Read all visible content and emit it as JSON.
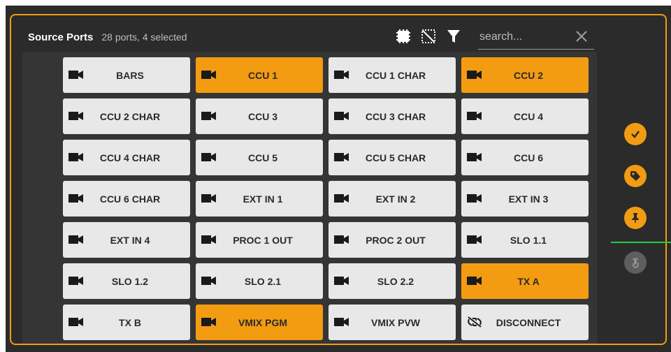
{
  "header": {
    "title": "Source Ports",
    "count_text": "28 ports, 4 selected"
  },
  "toolbar": {
    "icons": [
      "select-all-icon",
      "deselect-all-icon",
      "filter-icon"
    ],
    "search_placeholder": "search...",
    "search_value": "",
    "clear_icon": "close-icon"
  },
  "ports": [
    {
      "label": "BARS",
      "selected": false,
      "icon": "camera-icon"
    },
    {
      "label": "CCU 1",
      "selected": true,
      "icon": "camera-icon"
    },
    {
      "label": "CCU 1 CHAR",
      "selected": false,
      "icon": "camera-icon"
    },
    {
      "label": "CCU 2",
      "selected": true,
      "icon": "camera-icon"
    },
    {
      "label": "CCU 2 CHAR",
      "selected": false,
      "icon": "camera-icon"
    },
    {
      "label": "CCU 3",
      "selected": false,
      "icon": "camera-icon"
    },
    {
      "label": "CCU 3 CHAR",
      "selected": false,
      "icon": "camera-icon"
    },
    {
      "label": "CCU 4",
      "selected": false,
      "icon": "camera-icon"
    },
    {
      "label": "CCU 4 CHAR",
      "selected": false,
      "icon": "camera-icon"
    },
    {
      "label": "CCU 5",
      "selected": false,
      "icon": "camera-icon"
    },
    {
      "label": "CCU 5 CHAR",
      "selected": false,
      "icon": "camera-icon"
    },
    {
      "label": "CCU 6",
      "selected": false,
      "icon": "camera-icon"
    },
    {
      "label": "CCU 6 CHAR",
      "selected": false,
      "icon": "camera-icon"
    },
    {
      "label": "EXT IN 1",
      "selected": false,
      "icon": "camera-icon"
    },
    {
      "label": "EXT IN 2",
      "selected": false,
      "icon": "camera-icon"
    },
    {
      "label": "EXT IN 3",
      "selected": false,
      "icon": "camera-icon"
    },
    {
      "label": "EXT IN 4",
      "selected": false,
      "icon": "camera-icon"
    },
    {
      "label": "PROC 1 OUT",
      "selected": false,
      "icon": "camera-icon"
    },
    {
      "label": "PROC 2 OUT",
      "selected": false,
      "icon": "camera-icon"
    },
    {
      "label": "SLO 1.1",
      "selected": false,
      "icon": "camera-icon"
    },
    {
      "label": "SLO 1.2",
      "selected": false,
      "icon": "camera-icon"
    },
    {
      "label": "SLO 2.1",
      "selected": false,
      "icon": "camera-icon"
    },
    {
      "label": "SLO 2.2",
      "selected": false,
      "icon": "camera-icon"
    },
    {
      "label": "TX A",
      "selected": true,
      "icon": "camera-icon"
    },
    {
      "label": "TX B",
      "selected": false,
      "icon": "camera-icon"
    },
    {
      "label": "VMIX PGM",
      "selected": true,
      "icon": "camera-icon"
    },
    {
      "label": "VMIX PVW",
      "selected": false,
      "icon": "camera-icon"
    },
    {
      "label": "DISCONNECT",
      "selected": false,
      "icon": "unlink-icon"
    }
  ],
  "side_buttons": [
    {
      "name": "confirm-button",
      "icon": "check-icon",
      "enabled": true
    },
    {
      "name": "tag-button",
      "icon": "tag-icon",
      "enabled": true
    },
    {
      "name": "pin-button",
      "icon": "pin-icon",
      "enabled": true
    },
    {
      "name": "touch-button",
      "icon": "touch-icon",
      "enabled": false
    }
  ],
  "colors": {
    "accent": "#f39c12",
    "panel_bg": "#2b2b2b",
    "tile_bg": "#e8e8e8",
    "divider": "#23d23a"
  }
}
